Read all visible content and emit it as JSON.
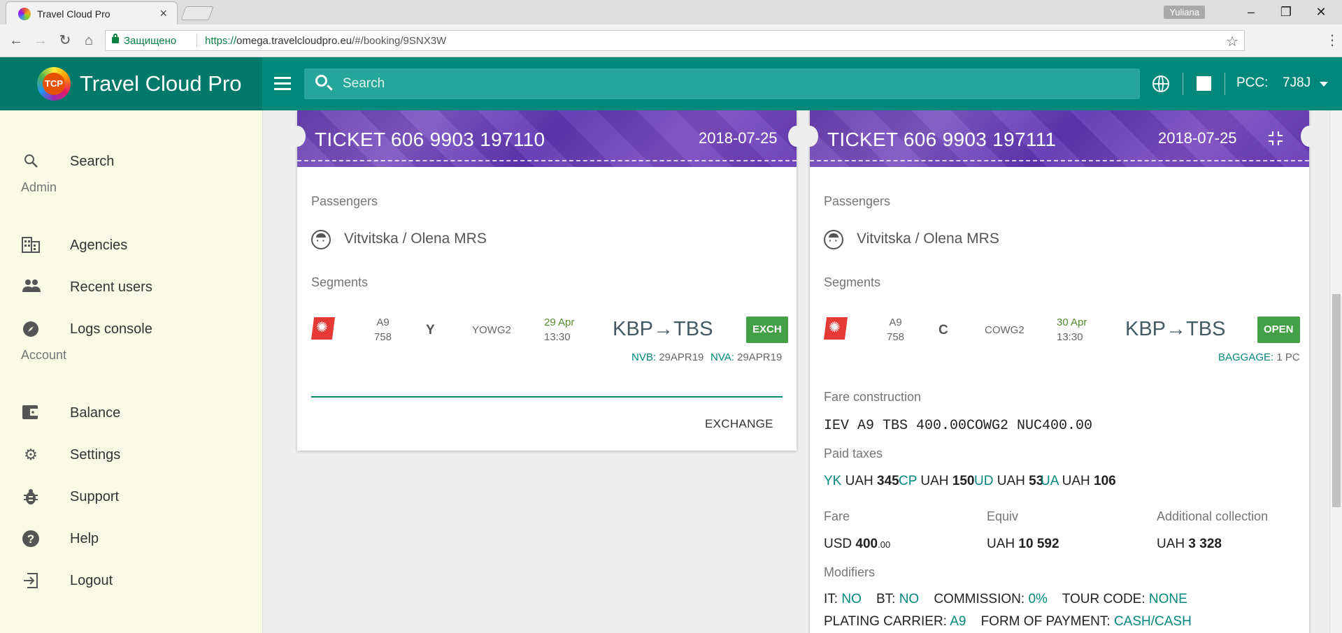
{
  "browser": {
    "tab_title": "Travel Cloud Pro",
    "user": "Yuliana",
    "secure_label": "Защищено",
    "url_scheme": "https://",
    "url_host": "omega.travelcloudpro.eu",
    "url_path": "/#/booking/9SNX3W"
  },
  "header": {
    "brand_name": "Travel Cloud Pro",
    "logo_text": "TCP",
    "search_placeholder": "Search",
    "pcc_label": "PCC:",
    "pcc_value": "7J8J"
  },
  "sidebar": {
    "search": "Search",
    "admin_section": "Admin",
    "agencies": "Agencies",
    "recent_users": "Recent users",
    "logs_console": "Logs console",
    "account_section": "Account",
    "balance": "Balance",
    "settings": "Settings",
    "support": "Support",
    "help": "Help",
    "logout": "Logout"
  },
  "tickets": [
    {
      "label": "TICKET  606 9903 197110",
      "date": "2018-07-25",
      "passengers_title": "Passengers",
      "passenger": "Vitvitska / Olena MRS",
      "segments_title": "Segments",
      "segment": {
        "carrier": "A9",
        "flight": "758",
        "class": "Y",
        "fare_basis": "YOWG2",
        "date": "29 Apr",
        "time": "13:30",
        "route": "KBP→TBS",
        "status": "EXCH",
        "nvb_label": "NVB:",
        "nvb_value": "29APR19",
        "nva_label": "NVA:",
        "nva_value": "29APR19"
      },
      "action": "EXCHANGE"
    },
    {
      "label": "TICKET  606 9903 197111",
      "date": "2018-07-25",
      "passengers_title": "Passengers",
      "passenger": "Vitvitska / Olena MRS",
      "segments_title": "Segments",
      "segment": {
        "carrier": "A9",
        "flight": "758",
        "class": "C",
        "fare_basis": "COWG2",
        "date": "30 Apr",
        "time": "13:30",
        "route": "KBP→TBS",
        "status": "OPEN",
        "baggage_label": "BAGGAGE:",
        "baggage_value": "1 PC"
      },
      "fare_construction_title": "Fare construction",
      "fare_construction": "IEV A9 TBS 400.00COWG2 NUC400.00",
      "paid_taxes_title": "Paid taxes",
      "taxes": [
        {
          "code": "YK",
          "currency": "UAH",
          "amount": "345"
        },
        {
          "code": "CP",
          "currency": "UAH",
          "amount": "150"
        },
        {
          "code": "UD",
          "currency": "UAH",
          "amount": "53"
        },
        {
          "code": "UA",
          "currency": "UAH",
          "amount": "106"
        }
      ],
      "fare_title": "Fare",
      "fare_currency": "USD",
      "fare_amount": "400",
      "fare_cents": ".00",
      "equiv_title": "Equiv",
      "equiv_currency": "UAH",
      "equiv_amount": "10 592",
      "additional_title": "Additional collection",
      "additional_currency": "UAH",
      "additional_amount": "3 328",
      "modifiers_title": "Modifiers",
      "modifiers": {
        "it_label": "IT:",
        "it_value": "NO",
        "bt_label": "BT:",
        "bt_value": "NO",
        "commission_label": "COMMISSION:",
        "commission_value": "0%",
        "tour_code_label": "TOUR CODE:",
        "tour_code_value": "NONE",
        "plating_label": "PLATING CARRIER:",
        "plating_value": "A9",
        "payment_label": "FORM OF PAYMENT:",
        "payment_value": "CASH/CASH"
      }
    }
  ],
  "colors": {
    "header_bg": "#00897b",
    "brand_bg": "#00796b",
    "ticket_header": "#673ab7",
    "status_green": "#43a047",
    "accent_teal": "#00897b"
  }
}
